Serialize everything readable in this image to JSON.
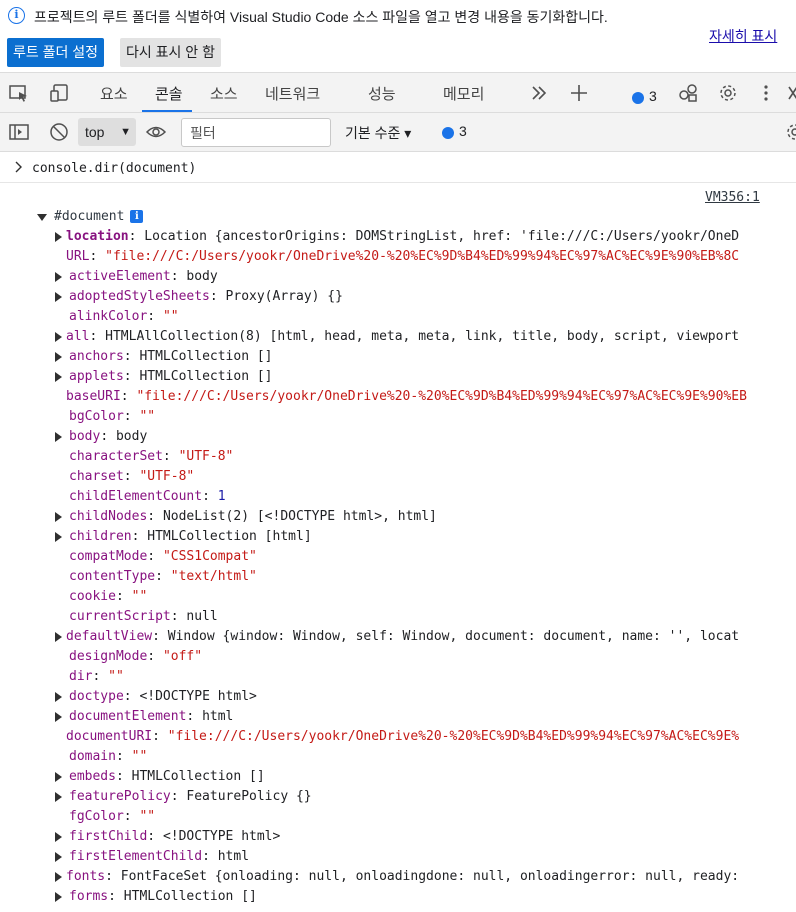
{
  "infobar": {
    "message": "프로젝트의 루트 폴더를 식별하여 Visual Studio Code 소스 파일을 열고 변경 내용을 동기화합니다.",
    "learn_more": "자세히 표시",
    "primary_button": "루트 폴더 설정",
    "secondary_button": "다시 표시 안 함"
  },
  "tabs": [
    {
      "label": "요소"
    },
    {
      "label": "콘솔"
    },
    {
      "label": "소스"
    },
    {
      "label": "네트워크"
    },
    {
      "label": "성능"
    },
    {
      "label": "메모리"
    }
  ],
  "active_tab": "콘솔",
  "issues_count": "3",
  "console_toolbar": {
    "context": "top",
    "filter_placeholder": "필터",
    "level": "기본 수준 ▾",
    "messages_count": "3"
  },
  "console": {
    "input_command": "console.dir(document)",
    "source_link": "VM356:1",
    "root_label": "#document",
    "properties": [
      {
        "key": "location",
        "value": "Location {ancestorOrigins: DOMStringList, href: 'file:///C:/Users/yookr/OneD",
        "expandable": true,
        "bold": true
      },
      {
        "key": "URL",
        "value": "\"file:///C:/Users/yookr/OneDrive%20-%20%EC%9D%B4%ED%99%94%EC%97%AC%EC%9E%90%EB%8C",
        "expandable": false,
        "type": "string"
      },
      {
        "key": "activeElement",
        "value": "body",
        "expandable": true
      },
      {
        "key": "adoptedStyleSheets",
        "value": "Proxy(Array) {}",
        "expandable": true
      },
      {
        "key": "alinkColor",
        "value": "\"\"",
        "expandable": false,
        "type": "string"
      },
      {
        "key": "all",
        "value": "HTMLAllCollection(8) [html, head, meta, meta, link, title, body, script, viewport",
        "expandable": true
      },
      {
        "key": "anchors",
        "value": "HTMLCollection []",
        "expandable": true
      },
      {
        "key": "applets",
        "value": "HTMLCollection []",
        "expandable": true
      },
      {
        "key": "baseURI",
        "value": "\"file:///C:/Users/yookr/OneDrive%20-%20%EC%9D%B4%ED%99%94%EC%97%AC%EC%9E%90%EB",
        "expandable": false,
        "type": "string"
      },
      {
        "key": "bgColor",
        "value": "\"\"",
        "expandable": false,
        "type": "string"
      },
      {
        "key": "body",
        "value": "body",
        "expandable": true
      },
      {
        "key": "characterSet",
        "value": "\"UTF-8\"",
        "expandable": false,
        "type": "string"
      },
      {
        "key": "charset",
        "value": "\"UTF-8\"",
        "expandable": false,
        "type": "string"
      },
      {
        "key": "childElementCount",
        "value": "1",
        "expandable": false,
        "type": "number"
      },
      {
        "key": "childNodes",
        "value": "NodeList(2) [<!DOCTYPE html>, html]",
        "expandable": true
      },
      {
        "key": "children",
        "value": "HTMLCollection [html]",
        "expandable": true
      },
      {
        "key": "compatMode",
        "value": "\"CSS1Compat\"",
        "expandable": false,
        "type": "string"
      },
      {
        "key": "contentType",
        "value": "\"text/html\"",
        "expandable": false,
        "type": "string"
      },
      {
        "key": "cookie",
        "value": "\"\"",
        "expandable": false,
        "type": "string"
      },
      {
        "key": "currentScript",
        "value": "null",
        "expandable": false,
        "type": "null"
      },
      {
        "key": "defaultView",
        "value": "Window {window: Window, self: Window, document: document, name: '', locat",
        "expandable": true
      },
      {
        "key": "designMode",
        "value": "\"off\"",
        "expandable": false,
        "type": "string"
      },
      {
        "key": "dir",
        "value": "\"\"",
        "expandable": false,
        "type": "string"
      },
      {
        "key": "doctype",
        "value": "<!DOCTYPE html>",
        "expandable": true
      },
      {
        "key": "documentElement",
        "value": "html",
        "expandable": true
      },
      {
        "key": "documentURI",
        "value": "\"file:///C:/Users/yookr/OneDrive%20-%20%EC%9D%B4%ED%99%94%EC%97%AC%EC%9E%",
        "expandable": false,
        "type": "string"
      },
      {
        "key": "domain",
        "value": "\"\"",
        "expandable": false,
        "type": "string"
      },
      {
        "key": "embeds",
        "value": "HTMLCollection []",
        "expandable": true
      },
      {
        "key": "featurePolicy",
        "value": "FeaturePolicy {}",
        "expandable": true
      },
      {
        "key": "fgColor",
        "value": "\"\"",
        "expandable": false,
        "type": "string"
      },
      {
        "key": "firstChild",
        "value": "<!DOCTYPE html>",
        "expandable": true
      },
      {
        "key": "firstElementChild",
        "value": "html",
        "expandable": true
      },
      {
        "key": "fonts",
        "value": "FontFaceSet {onloading: null, onloadingdone: null, onloadingerror: null, ready:",
        "expandable": true
      },
      {
        "key": "forms",
        "value": "HTMLCollection []",
        "expandable": true
      }
    ]
  },
  "colors": {
    "accent": "#1a73e8",
    "primary_button": "#0b6fd0",
    "property_key": "#881280",
    "string_value": "#c41a16",
    "number_value": "#1a1aa6"
  }
}
